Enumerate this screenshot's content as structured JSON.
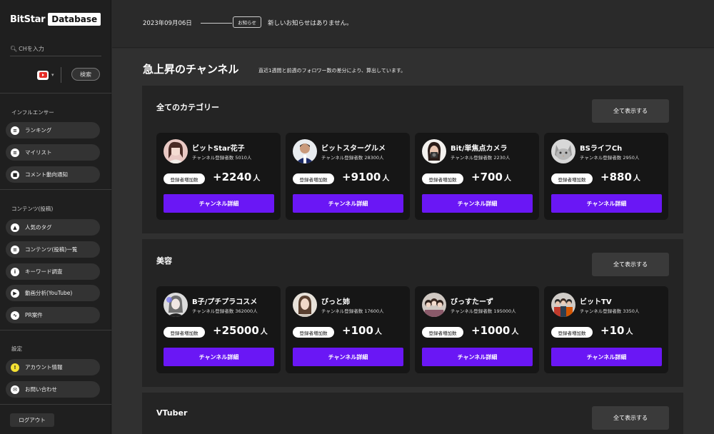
{
  "brand": {
    "name": "BitStar",
    "badge": "Database"
  },
  "search": {
    "placeholder": "CHを入力",
    "button": "検索"
  },
  "sidebar": {
    "sections": [
      {
        "label": "インフルエンサー",
        "items": [
          {
            "label": "ランキング",
            "icon": "chart-icon"
          },
          {
            "label": "マイリスト",
            "icon": "list-icon"
          },
          {
            "label": "コメント動向通知",
            "icon": "comment-icon"
          }
        ]
      },
      {
        "label": "コンテンツ(投稿)",
        "items": [
          {
            "label": "人気のタグ",
            "icon": "flame-icon"
          },
          {
            "label": "コンテンツ(投稿)一覧",
            "icon": "list-icon"
          },
          {
            "label": "キーワード調査",
            "icon": "info-icon"
          },
          {
            "label": "動画分析(YouTube)",
            "icon": "video-icon"
          },
          {
            "label": "PR案件",
            "icon": "trend-icon"
          }
        ]
      },
      {
        "label": "設定",
        "items": [
          {
            "label": "アカウント情報",
            "icon": "alert-icon"
          },
          {
            "label": "お問い合わせ",
            "icon": "mail-icon"
          }
        ]
      }
    ],
    "logout": "ログアウト"
  },
  "topbar": {
    "date": "2023年09月06日",
    "badge": "お知らせ",
    "notice": "新しいお知らせはありません。"
  },
  "main": {
    "title": "急上昇のチャンネル",
    "subtitle": "直近1週間と前週のフォロワー数の差分により、算出しています。",
    "show_all": "全て表示する",
    "inc_label": "登録者増加数",
    "detail_button": "チャンネル詳細",
    "unit": "人",
    "sections": [
      {
        "title": "全てのカテゴリー",
        "cards": [
          {
            "name": "ビットStar花子",
            "subs": "チャンネル登録者数 5010人",
            "inc": "+2240"
          },
          {
            "name": "ビットスターグルメ",
            "subs": "チャンネル登録者数 28300人",
            "inc": "+9100"
          },
          {
            "name": "Bit/単焦点カメラ",
            "subs": "チャンネル登録者数 2230人",
            "inc": "+700"
          },
          {
            "name": "BSライフCh",
            "subs": "チャンネル登録者数 2950人",
            "inc": "+880"
          }
        ]
      },
      {
        "title": "美容",
        "cards": [
          {
            "name": "B子/プチプラコスメ",
            "subs": "チャンネル登録者数 362000人",
            "inc": "+25000"
          },
          {
            "name": "びっと姉",
            "subs": "チャンネル登録者数 17600人",
            "inc": "+100"
          },
          {
            "name": "びっすたーず",
            "subs": "チャンネル登録者数 195000人",
            "inc": "+1000"
          },
          {
            "name": "ビットTV",
            "subs": "チャンネル登録者数 3350人",
            "inc": "+10"
          }
        ]
      },
      {
        "title": "VTuber",
        "cards": []
      }
    ]
  }
}
